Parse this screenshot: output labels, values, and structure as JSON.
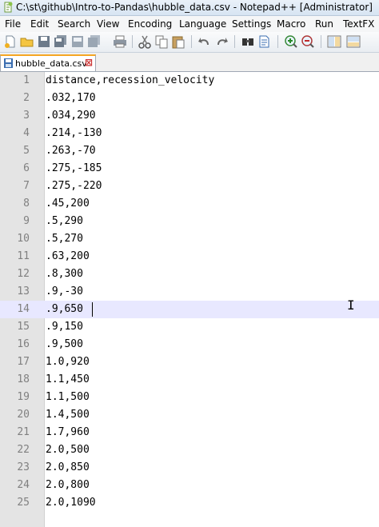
{
  "window": {
    "title": "C:\\st\\github\\Intro-to-Pandas\\hubble_data.csv - Notepad++ [Administrator]"
  },
  "menu": [
    "File",
    "Edit",
    "Search",
    "View",
    "Encoding",
    "Language",
    "Settings",
    "Macro",
    "Run",
    "TextFX"
  ],
  "toolbar": {
    "icons": [
      "new-file-icon",
      "open-file-icon",
      "save-icon",
      "save-all-icon",
      "close-icon",
      "close-all-icon",
      "print-icon",
      "cut-icon",
      "copy-icon",
      "paste-icon",
      "undo-icon",
      "redo-icon",
      "find-icon",
      "replace-icon",
      "zoom-in-icon",
      "zoom-out-icon",
      "sync-vertical-icon",
      "sync-horizontal-icon"
    ]
  },
  "tab": {
    "label": "hubble_data.csv",
    "close": "⊠"
  },
  "editor": {
    "current_line": 14,
    "lines": [
      {
        "num": "1",
        "text": "distance,recession_velocity"
      },
      {
        "num": "2",
        "text": ".032,170"
      },
      {
        "num": "3",
        "text": ".034,290"
      },
      {
        "num": "4",
        "text": ".214,-130"
      },
      {
        "num": "5",
        "text": ".263,-70"
      },
      {
        "num": "6",
        "text": ".275,-185"
      },
      {
        "num": "7",
        "text": ".275,-220"
      },
      {
        "num": "8",
        "text": ".45,200"
      },
      {
        "num": "9",
        "text": ".5,290"
      },
      {
        "num": "10",
        "text": ".5,270"
      },
      {
        "num": "11",
        "text": ".63,200"
      },
      {
        "num": "12",
        "text": ".8,300"
      },
      {
        "num": "13",
        "text": ".9,-30"
      },
      {
        "num": "14",
        "text": ".9,650"
      },
      {
        "num": "15",
        "text": ".9,150"
      },
      {
        "num": "16",
        "text": ".9,500"
      },
      {
        "num": "17",
        "text": "1.0,920"
      },
      {
        "num": "18",
        "text": "1.1,450"
      },
      {
        "num": "19",
        "text": "1.1,500"
      },
      {
        "num": "20",
        "text": "1.4,500"
      },
      {
        "num": "21",
        "text": "1.7,960"
      },
      {
        "num": "22",
        "text": "2.0,500"
      },
      {
        "num": "23",
        "text": "2.0,850"
      },
      {
        "num": "24",
        "text": "2.0,800"
      },
      {
        "num": "25",
        "text": "2.0,1090"
      }
    ]
  }
}
